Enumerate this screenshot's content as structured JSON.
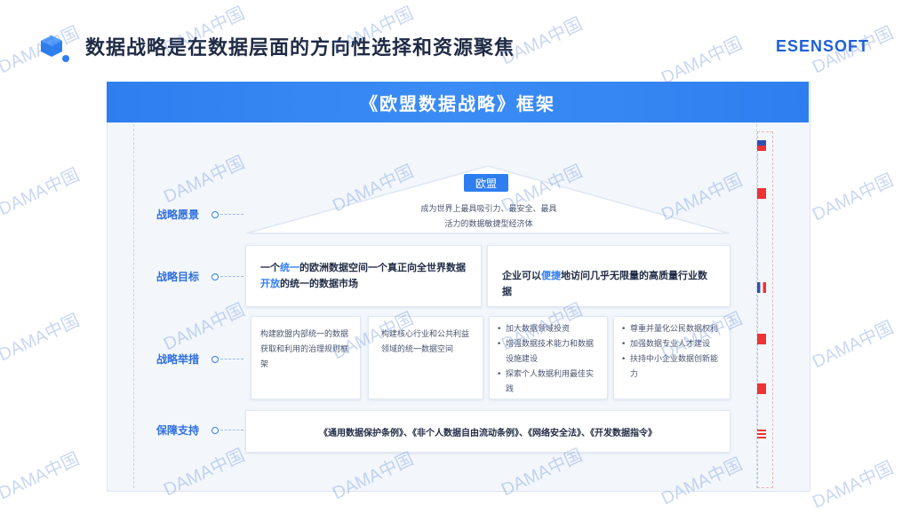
{
  "header": {
    "title": "数据战略是在数据层面的方向性选择和资源聚焦",
    "brand": "ESENSOFT"
  },
  "framework": {
    "title": "《欧盟数据战略》框架",
    "top_tag": "欧盟",
    "vision_line1": "成为世界上最具吸引力、最安全、最具",
    "vision_line2": "活力的数据敏捷型经济体"
  },
  "rows": {
    "vision_label": "战略愿景",
    "goal_label": "战略目标",
    "measure_label": "战略举措",
    "support_label": "保障支持"
  },
  "goals": {
    "left_part1": "一个",
    "left_hl1": "统一",
    "left_part2": "的欧洲数据空间一个真正向全世界数据",
    "left_hl2": "开放",
    "left_part3": "的统一的数据市场",
    "right_part1": "企业可以",
    "right_hl": "便捷",
    "right_part2": "地访问几乎无限量的高质量行业数据"
  },
  "measures": {
    "m1": "构建欧盟内部统一的数据获取和利用的治理规则框架",
    "m2": "构建核心行业和公共利益领域的统一数据空间",
    "m3": [
      "加大数据领域投资",
      "增强数据技术能力和数据设施建设",
      "探索个人数据利用最佳实践"
    ],
    "m4": [
      "尊重并量化公民数据权利",
      "加强数据专业人才建设",
      "扶持中小企业数据创新能力"
    ]
  },
  "support": {
    "laws": "《通用数据保护条例》、《非个人数据自由流动条例》、《网络安全法》、《开发数据指令》"
  },
  "watermark": "DAMA中国",
  "colors": {
    "accent": "#2f7ef0",
    "title": "#1f2a44"
  }
}
